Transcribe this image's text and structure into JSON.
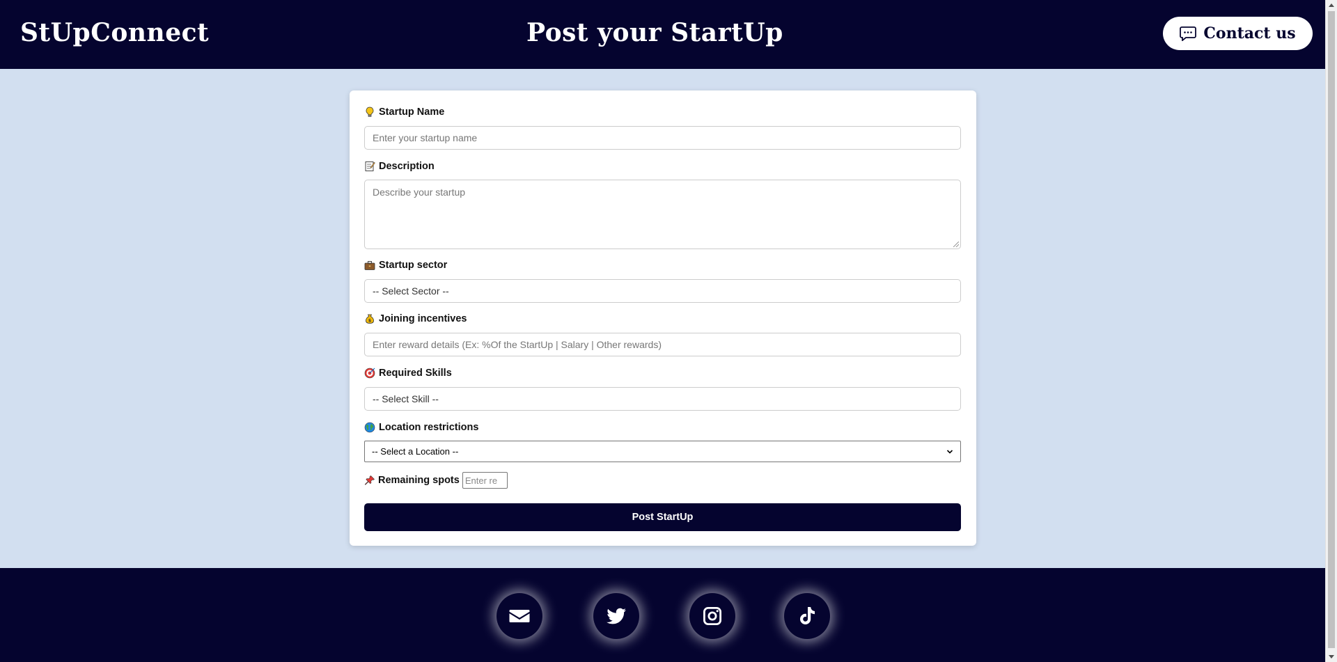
{
  "header": {
    "brand": "StUpConnect",
    "title": "Post your StartUp",
    "contact_label": "Contact us"
  },
  "form": {
    "startup_name": {
      "label": "Startup Name",
      "placeholder": "Enter your startup name",
      "icon": "lightbulb-icon"
    },
    "description": {
      "label": "Description",
      "placeholder": "Describe your startup",
      "icon": "memo-icon"
    },
    "sector": {
      "label": "Startup sector",
      "value": "-- Select Sector --",
      "icon": "briefcase-icon"
    },
    "incentives": {
      "label": "Joining incentives",
      "placeholder": "Enter reward details (Ex: %Of the StartUp | Salary | Other rewards)",
      "icon": "money-bag-icon"
    },
    "skills": {
      "label": "Required Skills",
      "value": "-- Select Skill --",
      "icon": "target-icon"
    },
    "location": {
      "label": "Location restrictions",
      "value": "-- Select a Location --",
      "icon": "globe-icon"
    },
    "spots": {
      "label": "Remaining spots",
      "placeholder": "Enter re",
      "icon": "pushpin-icon"
    },
    "submit_label": "Post StartUp"
  },
  "footer": {
    "socials": [
      "email-icon",
      "twitter-icon",
      "instagram-icon",
      "tiktok-icon"
    ]
  },
  "colors": {
    "navy": "#05042f",
    "page_bg": "#d2dff0",
    "card_bg": "#ffffff"
  }
}
